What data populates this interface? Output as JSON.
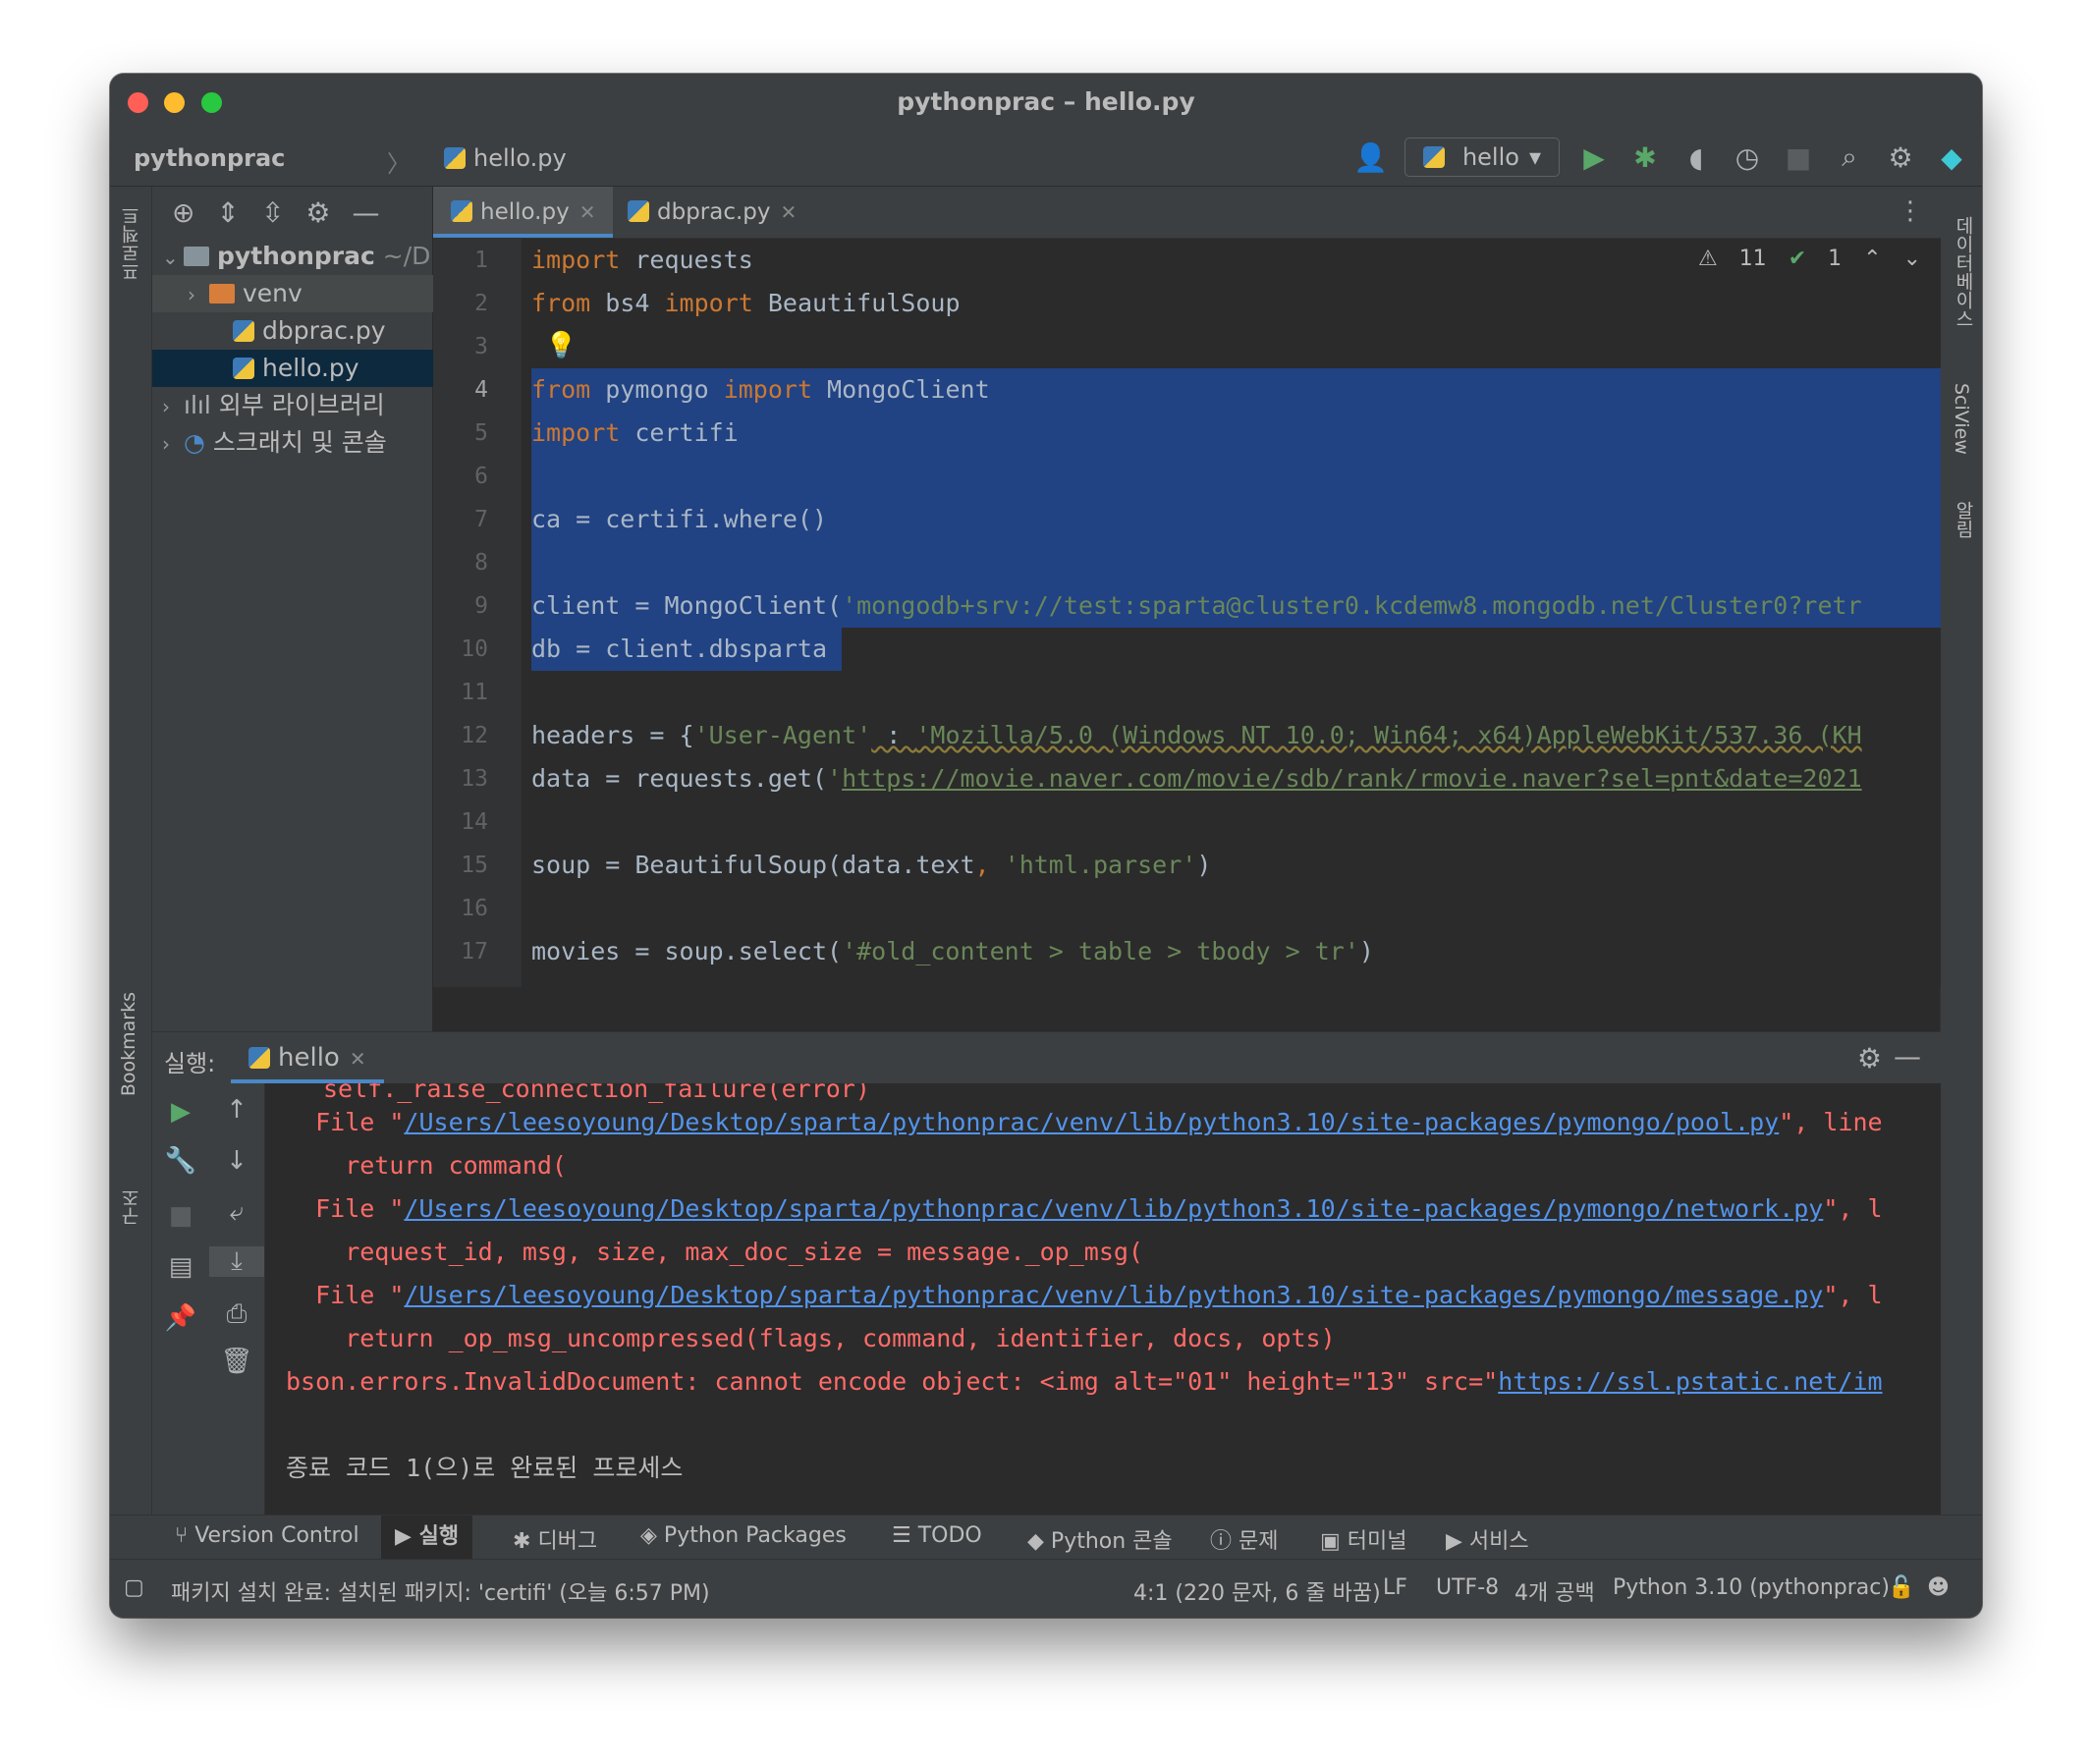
{
  "window": {
    "title": "pythonprac – hello.py"
  },
  "navbar": {
    "project": "pythonprac",
    "file": "hello.py",
    "run_config": "hello"
  },
  "left_strip": {
    "project_label": "프로젝트",
    "bookmarks_label": "Bookmarks",
    "structure_label": "구조"
  },
  "right_strip": {
    "database_label": "데이터베이스",
    "sciview_label": "SciView",
    "notifications_label": "알림"
  },
  "project_tree": [
    {
      "label": "pythonprac",
      "suffix": "~/D"
    },
    {
      "label": "venv"
    },
    {
      "label": "dbprac.py"
    },
    {
      "label": "hello.py"
    },
    {
      "label": "외부 라이브러리"
    },
    {
      "label": "스크래치 및 콘솔"
    }
  ],
  "tabs": [
    {
      "label": "hello.py"
    },
    {
      "label": "dbprac.py"
    }
  ],
  "inspections": {
    "warnings": "11",
    "ok": "1"
  },
  "code_lines": [
    {
      "n": "1"
    },
    {
      "n": "2"
    },
    {
      "n": "3"
    },
    {
      "n": "4"
    },
    {
      "n": "5"
    },
    {
      "n": "6"
    },
    {
      "n": "7"
    },
    {
      "n": "8"
    },
    {
      "n": "9"
    },
    {
      "n": "10"
    },
    {
      "n": "11"
    },
    {
      "n": "12"
    },
    {
      "n": "13"
    },
    {
      "n": "14"
    },
    {
      "n": "15"
    },
    {
      "n": "16"
    },
    {
      "n": "17"
    }
  ],
  "code": {
    "l1_kw": "import",
    "l1_rest": " requests",
    "l2_kw1": "from",
    "l2_mid": " bs4 ",
    "l2_kw2": "import",
    "l2_rest": " BeautifulSoup",
    "l4_kw1": "from",
    "l4_mid": " pymongo ",
    "l4_kw2": "import",
    "l4_rest": " MongoClient",
    "l5_kw": "import",
    "l5_rest": " certifi",
    "l7": "ca = certifi.where()",
    "l9_pre": "client = MongoClient(",
    "l9_str": "'mongodb+srv://test:sparta@cluster0.kcdemw8.mongodb.net/Cluster0?retr",
    "l10": "db = client.dbsparta",
    "l12_pre": "headers = {",
    "l12_key": "'User-Agent'",
    "l12_colon": " : ",
    "l12_val": "'Mozilla/5.0 (Windows NT 10.0; Win64; x64)AppleWebKit/537.36 (KH",
    "l13_pre": "data = requests.get(",
    "l13_q": "'",
    "l13_url": "https://movie.naver.com/movie/sdb/rank/rmovie.naver?sel=pnt&date=2021",
    "l15_pre": "soup = BeautifulSoup(data.text",
    "l15_comma": ", ",
    "l15_str": "'html.parser'",
    "l15_post": ")",
    "l17_pre": "movies = soup.select(",
    "l17_str": "'#old_content > table > tbody > tr'",
    "l17_post": ")"
  },
  "run_panel": {
    "label": "실행:",
    "tab": "hello"
  },
  "console": {
    "c0": "self._raise_connection_failure(error)",
    "c1_pre": "  File \"",
    "c1_link": "/Users/leesoyoung/Desktop/sparta/pythonprac/venv/lib/python3.10/site-packages/pymongo/pool.py",
    "c1_post": "\", line",
    "c2": "    return command(",
    "c3_pre": "  File \"",
    "c3_link": "/Users/leesoyoung/Desktop/sparta/pythonprac/venv/lib/python3.10/site-packages/pymongo/network.py",
    "c3_post": "\", l",
    "c4": "    request_id, msg, size, max_doc_size = message._op_msg(",
    "c5_pre": "  File \"",
    "c5_link": "/Users/leesoyoung/Desktop/sparta/pythonprac/venv/lib/python3.10/site-packages/pymongo/message.py",
    "c5_post": "\", l",
    "c6": "    return _op_msg_uncompressed(flags, command, identifier, docs, opts)",
    "c7_pre": "bson.errors.InvalidDocument: cannot encode object: <img alt=\"01\" height=\"13\" src=\"",
    "c7_link": "https://ssl.pstatic.net/im",
    "c9": "종료 코드 1(으)로 완료된 프로세스"
  },
  "bottom_tools": [
    {
      "label": "Version Control"
    },
    {
      "label": "실행"
    },
    {
      "label": "디버그"
    },
    {
      "label": "Python Packages"
    },
    {
      "label": "TODO"
    },
    {
      "label": "Python 콘솔"
    },
    {
      "label": "문제"
    },
    {
      "label": "터미널"
    },
    {
      "label": "서비스"
    }
  ],
  "status": {
    "message": "패키지 설치 완료: 설치된 패키지: 'certifi' (오늘 6:57 PM)",
    "position": "4:1 (220 문자, 6 줄 바꿈)",
    "line_sep": "LF",
    "encoding": "UTF-8",
    "indent": "4개 공백",
    "interpreter": "Python 3.10 (pythonprac)"
  },
  "colors": {
    "accent": "#4a88c7",
    "keyword": "#cc7832",
    "string": "#6a8759",
    "error": "#ff6b68",
    "selection": "#214283"
  }
}
